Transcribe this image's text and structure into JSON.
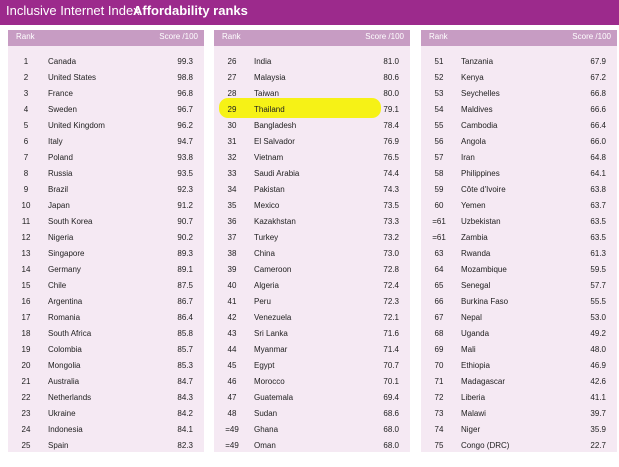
{
  "header": {
    "index_label": "Inclusive Internet Index",
    "title": "Affordability ranks"
  },
  "columns": {
    "rank_label": "Rank",
    "score_label": "Score /100"
  },
  "highlight_color": "#f5f20a",
  "panels": [
    {
      "rows": [
        {
          "rank": "1",
          "country": "Canada",
          "score": "99.3"
        },
        {
          "rank": "2",
          "country": "United States",
          "score": "98.8"
        },
        {
          "rank": "3",
          "country": "France",
          "score": "96.8"
        },
        {
          "rank": "4",
          "country": "Sweden",
          "score": "96.7"
        },
        {
          "rank": "5",
          "country": "United Kingdom",
          "score": "96.2"
        },
        {
          "rank": "6",
          "country": "Italy",
          "score": "94.7"
        },
        {
          "rank": "7",
          "country": "Poland",
          "score": "93.8"
        },
        {
          "rank": "8",
          "country": "Russia",
          "score": "93.5"
        },
        {
          "rank": "9",
          "country": "Brazil",
          "score": "92.3"
        },
        {
          "rank": "10",
          "country": "Japan",
          "score": "91.2"
        },
        {
          "rank": "11",
          "country": "South Korea",
          "score": "90.7"
        },
        {
          "rank": "12",
          "country": "Nigeria",
          "score": "90.2"
        },
        {
          "rank": "13",
          "country": "Singapore",
          "score": "89.3"
        },
        {
          "rank": "14",
          "country": "Germany",
          "score": "89.1"
        },
        {
          "rank": "15",
          "country": "Chile",
          "score": "87.5"
        },
        {
          "rank": "16",
          "country": "Argentina",
          "score": "86.7"
        },
        {
          "rank": "17",
          "country": "Romania",
          "score": "86.4"
        },
        {
          "rank": "18",
          "country": "South Africa",
          "score": "85.8"
        },
        {
          "rank": "19",
          "country": "Colombia",
          "score": "85.7"
        },
        {
          "rank": "20",
          "country": "Mongolia",
          "score": "85.3"
        },
        {
          "rank": "21",
          "country": "Australia",
          "score": "84.7"
        },
        {
          "rank": "22",
          "country": "Netherlands",
          "score": "84.3"
        },
        {
          "rank": "23",
          "country": "Ukraine",
          "score": "84.2"
        },
        {
          "rank": "24",
          "country": "Indonesia",
          "score": "84.1"
        },
        {
          "rank": "25",
          "country": "Spain",
          "score": "82.3"
        }
      ]
    },
    {
      "rows": [
        {
          "rank": "26",
          "country": "India",
          "score": "81.0"
        },
        {
          "rank": "27",
          "country": "Malaysia",
          "score": "80.6"
        },
        {
          "rank": "28",
          "country": "Taiwan",
          "score": "80.0"
        },
        {
          "rank": "29",
          "country": "Thailand",
          "score": "79.1"
        },
        {
          "rank": "30",
          "country": "Bangladesh",
          "score": "78.4"
        },
        {
          "rank": "31",
          "country": "El Salvador",
          "score": "76.9"
        },
        {
          "rank": "32",
          "country": "Vietnam",
          "score": "76.5"
        },
        {
          "rank": "33",
          "country": "Saudi Arabia",
          "score": "74.4"
        },
        {
          "rank": "34",
          "country": "Pakistan",
          "score": "74.3"
        },
        {
          "rank": "35",
          "country": "Mexico",
          "score": "73.5"
        },
        {
          "rank": "36",
          "country": "Kazakhstan",
          "score": "73.3"
        },
        {
          "rank": "37",
          "country": "Turkey",
          "score": "73.2"
        },
        {
          "rank": "38",
          "country": "China",
          "score": "73.0"
        },
        {
          "rank": "39",
          "country": "Cameroon",
          "score": "72.8"
        },
        {
          "rank": "40",
          "country": "Algeria",
          "score": "72.4"
        },
        {
          "rank": "41",
          "country": "Peru",
          "score": "72.3"
        },
        {
          "rank": "42",
          "country": "Venezuela",
          "score": "72.1"
        },
        {
          "rank": "43",
          "country": "Sri Lanka",
          "score": "71.6"
        },
        {
          "rank": "44",
          "country": "Myanmar",
          "score": "71.4"
        },
        {
          "rank": "45",
          "country": "Egypt",
          "score": "70.7"
        },
        {
          "rank": "46",
          "country": "Morocco",
          "score": "70.1"
        },
        {
          "rank": "47",
          "country": "Guatemala",
          "score": "69.4"
        },
        {
          "rank": "48",
          "country": "Sudan",
          "score": "68.6"
        },
        {
          "rank": "=49",
          "country": "Ghana",
          "score": "68.0"
        },
        {
          "rank": "=49",
          "country": "Oman",
          "score": "68.0"
        }
      ]
    },
    {
      "rows": [
        {
          "rank": "51",
          "country": "Tanzania",
          "score": "67.9"
        },
        {
          "rank": "52",
          "country": "Kenya",
          "score": "67.2"
        },
        {
          "rank": "53",
          "country": "Seychelles",
          "score": "66.8"
        },
        {
          "rank": "54",
          "country": "Maldives",
          "score": "66.6"
        },
        {
          "rank": "55",
          "country": "Cambodia",
          "score": "66.4"
        },
        {
          "rank": "56",
          "country": "Angola",
          "score": "66.0"
        },
        {
          "rank": "57",
          "country": "Iran",
          "score": "64.8"
        },
        {
          "rank": "58",
          "country": "Philippines",
          "score": "64.1"
        },
        {
          "rank": "59",
          "country": "Côte d'Ivoire",
          "score": "63.8"
        },
        {
          "rank": "60",
          "country": "Yemen",
          "score": "63.7"
        },
        {
          "rank": "=61",
          "country": "Uzbekistan",
          "score": "63.5"
        },
        {
          "rank": "=61",
          "country": "Zambia",
          "score": "63.5"
        },
        {
          "rank": "63",
          "country": "Rwanda",
          "score": "61.3"
        },
        {
          "rank": "64",
          "country": "Mozambique",
          "score": "59.5"
        },
        {
          "rank": "65",
          "country": "Senegal",
          "score": "57.7"
        },
        {
          "rank": "66",
          "country": "Burkina Faso",
          "score": "55.5"
        },
        {
          "rank": "67",
          "country": "Nepal",
          "score": "53.0"
        },
        {
          "rank": "68",
          "country": "Uganda",
          "score": "49.2"
        },
        {
          "rank": "69",
          "country": "Mali",
          "score": "48.0"
        },
        {
          "rank": "70",
          "country": "Ethiopia",
          "score": "46.9"
        },
        {
          "rank": "71",
          "country": "Madagascar",
          "score": "42.6"
        },
        {
          "rank": "72",
          "country": "Liberia",
          "score": "41.1"
        },
        {
          "rank": "73",
          "country": "Malawi",
          "score": "39.7"
        },
        {
          "rank": "74",
          "country": "Niger",
          "score": "35.9"
        },
        {
          "rank": "75",
          "country": "Congo (DRC)",
          "score": "22.7"
        }
      ]
    }
  ]
}
